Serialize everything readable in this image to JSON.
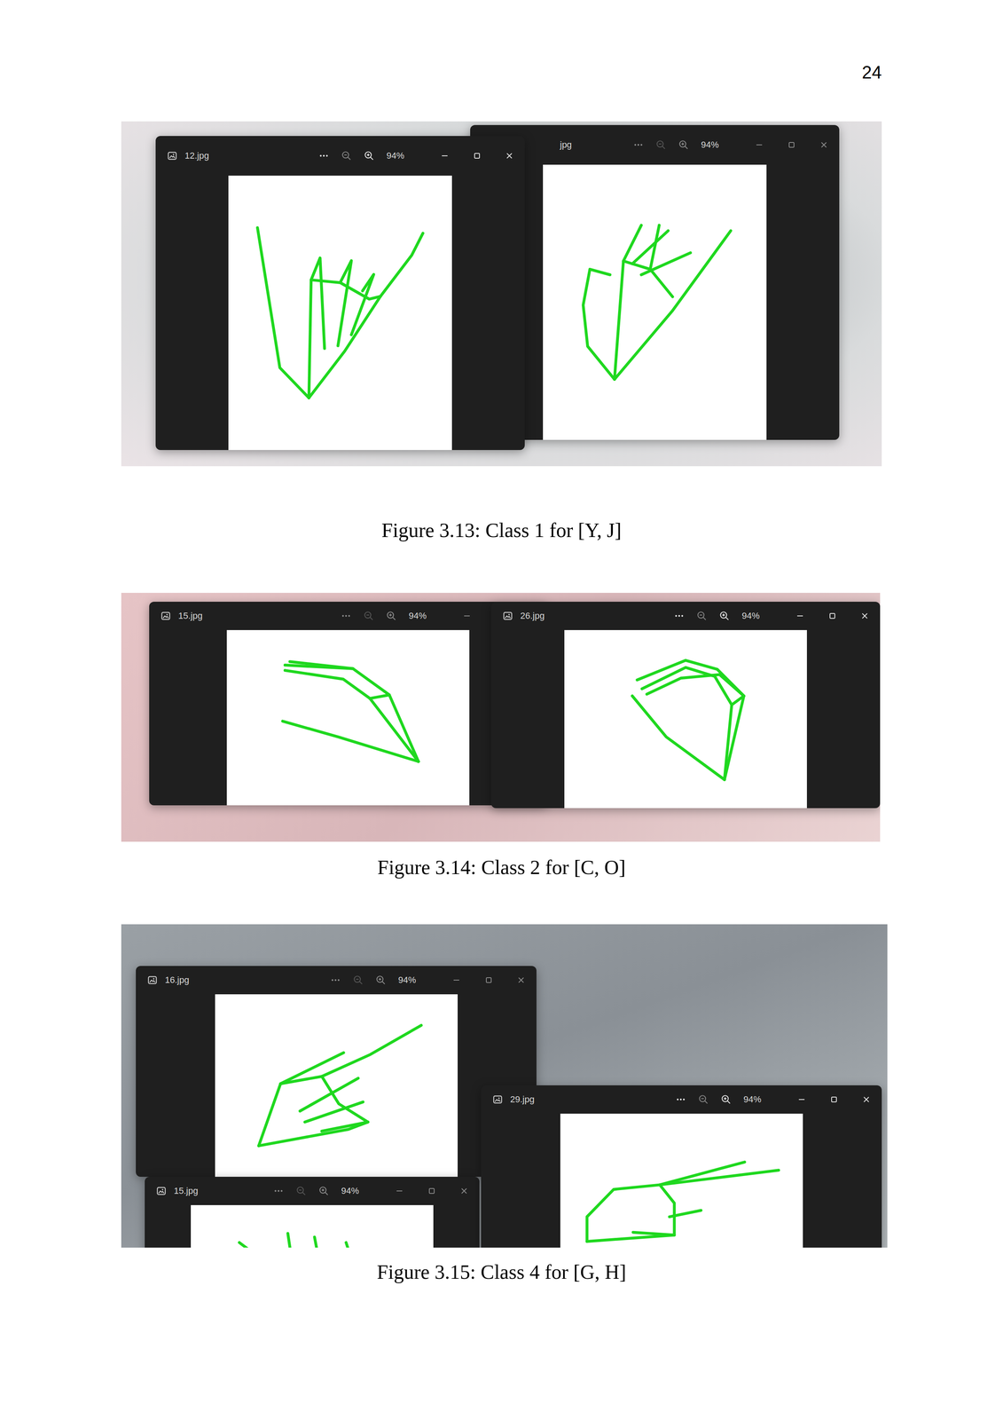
{
  "page_number": "24",
  "figures": [
    {
      "caption": "Figure 3.13: Class 1 for [Y, J]",
      "windows": [
        {
          "title": "12.jpg",
          "zoom": "94%",
          "active": true
        },
        {
          "title": "jpg",
          "zoom": "94%",
          "active": false
        }
      ]
    },
    {
      "caption": "Figure 3.14: Class 2 for [C, O]",
      "windows": [
        {
          "title": "15.jpg",
          "zoom": "94%",
          "active": false
        },
        {
          "title": "26.jpg",
          "zoom": "94%",
          "active": true
        }
      ]
    },
    {
      "caption": "Figure 3.15: Class 4 for [G, H]",
      "windows": [
        {
          "title": "16.jpg",
          "zoom": "94%",
          "active": false
        },
        {
          "title": "15.jpg",
          "zoom": "94%",
          "active": false
        },
        {
          "title": "29.jpg",
          "zoom": "94%",
          "active": true
        }
      ]
    }
  ]
}
